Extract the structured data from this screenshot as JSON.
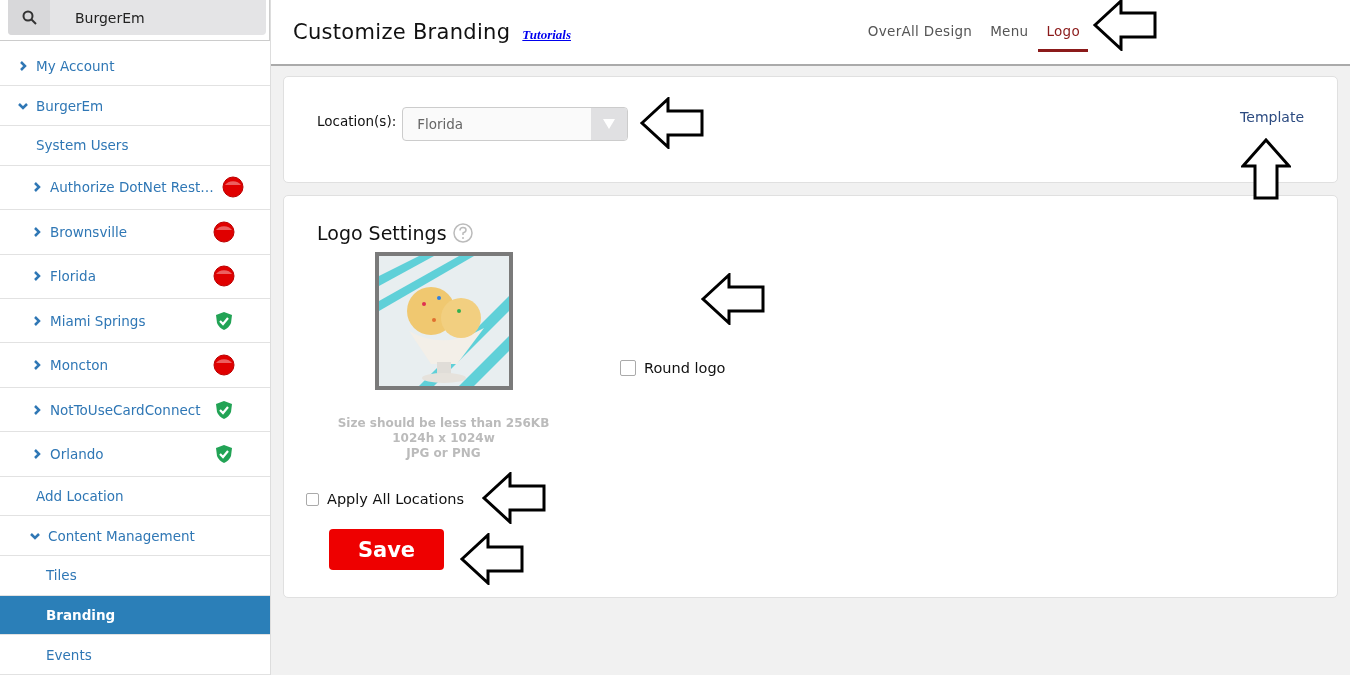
{
  "search": {
    "value": "BurgerEm"
  },
  "sidebar": {
    "items": [
      {
        "kind": "group",
        "label": "My Account",
        "expanded": false
      },
      {
        "kind": "group",
        "label": "BurgerEm",
        "expanded": true
      },
      {
        "kind": "link",
        "label": "System Users",
        "selected": false
      },
      {
        "kind": "location",
        "label": "Authorize DotNet Rest…",
        "active": false
      },
      {
        "kind": "location",
        "label": "Brownsville",
        "active": false
      },
      {
        "kind": "location",
        "label": "Florida",
        "active": false
      },
      {
        "kind": "location",
        "label": "Miami Springs",
        "active": true
      },
      {
        "kind": "location",
        "label": "Moncton",
        "active": false
      },
      {
        "kind": "location",
        "label": "NotToUseCardConnect",
        "active": true
      },
      {
        "kind": "location",
        "label": "Orlando",
        "active": true
      },
      {
        "kind": "link",
        "label": "Add Location",
        "selected": false
      },
      {
        "kind": "subgroup",
        "label": "Content Management",
        "expanded": true
      },
      {
        "kind": "sublink",
        "label": "Tiles",
        "selected": false
      },
      {
        "kind": "sublink",
        "label": "Branding",
        "selected": true
      },
      {
        "kind": "sublink",
        "label": "Events",
        "selected": false
      }
    ]
  },
  "header": {
    "title": "Customize Branding",
    "link": "Tutorials",
    "tabs": [
      {
        "label": "OverAll Design",
        "selected": false
      },
      {
        "label": "Menu",
        "selected": false
      },
      {
        "label": "Logo",
        "selected": true
      }
    ]
  },
  "location_card": {
    "label": "Location(s):",
    "value": "Florida",
    "template_link": "Template"
  },
  "logo_card": {
    "title": "Logo Settings",
    "hint_lines": [
      "Size should be less than 256KB",
      "1024h x 1024w",
      "JPG or PNG"
    ],
    "round_logo": {
      "label": "Round logo",
      "checked": false
    },
    "apply_all": {
      "label": "Apply All Locations",
      "checked": false
    },
    "save": "Save"
  }
}
